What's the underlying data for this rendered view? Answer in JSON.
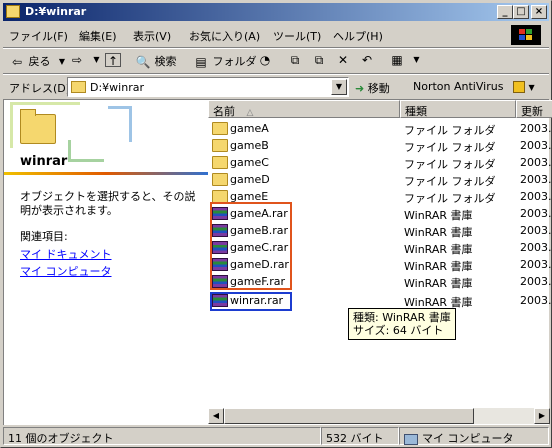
{
  "window": {
    "title": "D:¥winrar",
    "minimize": "_",
    "maximize": "□",
    "close": "×"
  },
  "menu": [
    "ファイル(F)",
    "編集(E)",
    "表示(V)",
    "お気に入り(A)",
    "ツール(T)",
    "ヘルプ(H)"
  ],
  "toolbar": {
    "back": "戻る",
    "search": "検索",
    "folders": "フォルダ"
  },
  "address": {
    "label": "アドレス(D)",
    "value": "D:¥winrar",
    "go": "移動",
    "norton": "Norton AntiVirus"
  },
  "left_pane": {
    "title": "winrar",
    "description": "オブジェクトを選択すると、その説明が表示されます。",
    "related_label": "関連項目:",
    "links": [
      "マイ ドキュメント",
      "マイ コンピュータ"
    ]
  },
  "columns": {
    "name": "名前",
    "type": "種類",
    "date": "更新"
  },
  "files": [
    {
      "name": "gameA",
      "type": "ファイル フォルダ",
      "date": "2003.",
      "kind": "folder"
    },
    {
      "name": "gameB",
      "type": "ファイル フォルダ",
      "date": "2003.",
      "kind": "folder"
    },
    {
      "name": "gameC",
      "type": "ファイル フォルダ",
      "date": "2003.",
      "kind": "folder"
    },
    {
      "name": "gameD",
      "type": "ファイル フォルダ",
      "date": "2003.",
      "kind": "folder"
    },
    {
      "name": "gameE",
      "type": "ファイル フォルダ",
      "date": "2003.",
      "kind": "folder"
    },
    {
      "name": "gameA.rar",
      "type": "WinRAR 書庫",
      "date": "2003.",
      "kind": "rar"
    },
    {
      "name": "gameB.rar",
      "type": "WinRAR 書庫",
      "date": "2003.",
      "kind": "rar"
    },
    {
      "name": "gameC.rar",
      "type": "WinRAR 書庫",
      "date": "2003.",
      "kind": "rar"
    },
    {
      "name": "gameD.rar",
      "type": "WinRAR 書庫",
      "date": "2003.",
      "kind": "rar"
    },
    {
      "name": "gameF.rar",
      "type": "WinRAR 書庫",
      "date": "2003.",
      "kind": "rar"
    },
    {
      "name": "winrar.rar",
      "type": "WinRAR 書庫",
      "date": "2003.",
      "kind": "rar"
    }
  ],
  "tooltip": {
    "line1": "種類: WinRAR 書庫",
    "line2": "サイズ: 64 バイト"
  },
  "status": {
    "count": "11 個のオブジェクト",
    "size": "532 バイト",
    "location": "マイ コンピュータ"
  },
  "colors": {
    "title_start": "#0a246a",
    "title_end": "#a6caf0",
    "highlight_red": "#e0541c",
    "highlight_blue": "#1c3cd0"
  }
}
